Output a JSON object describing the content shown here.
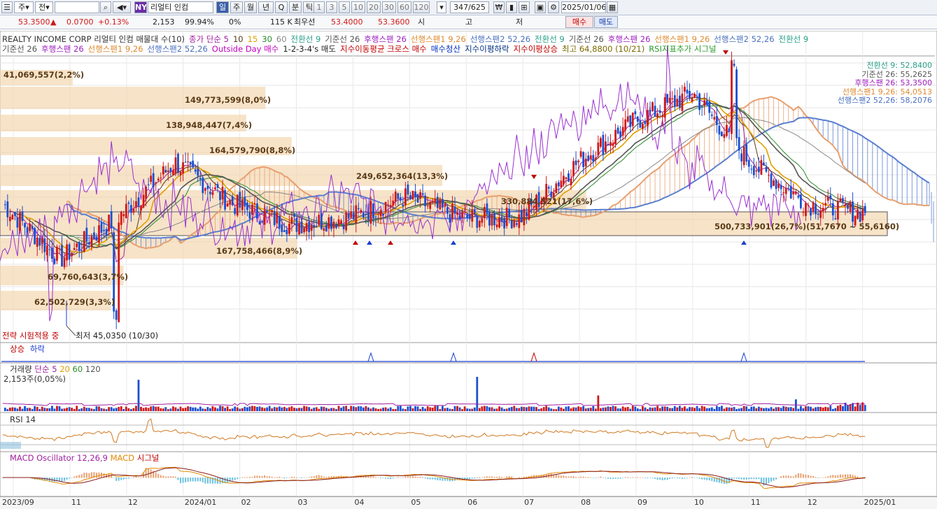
{
  "toolbar1": {
    "period": "주",
    "mode": "전",
    "code_value": "",
    "market_badge": "NY",
    "stock_name": "리얼티 인컴",
    "intervals": [
      "일",
      "주",
      "월",
      "년",
      "Q",
      "분",
      "틱"
    ],
    "minute_values": [
      "1",
      "3",
      "5",
      "10",
      "20",
      "30",
      "60",
      "120"
    ],
    "pagination": "347/625",
    "date": "2025/01/06",
    "buy_label": "매수",
    "sell_label": "매도"
  },
  "toolbar2": {
    "price": "53.3500",
    "change": "0.0700",
    "change_pct": "+0.13%",
    "volume": "2,153",
    "ratio": "99.94%",
    "zero_pct": "0%",
    "k_volume": "115 K",
    "best_ask_label": "최우선",
    "best_ask": "53.4000",
    "best_bid": "53.3600",
    "open_label": "시",
    "high_label": "고",
    "low_label": "저"
  },
  "legend1": [
    {
      "text": "REALTY INCOME CORP 리얼티 인컴 매물대 수(10)",
      "color": "#333333"
    },
    {
      "text": "종가 단순 5",
      "color": "#a020a0"
    },
    {
      "text": "10",
      "color": "#5a3b17"
    },
    {
      "text": "15",
      "color": "#e0a000"
    },
    {
      "text": "30",
      "color": "#2a8a2a"
    },
    {
      "text": "60",
      "color": "#888888"
    },
    {
      "text": "전환선 9",
      "color": "#2aa08a"
    },
    {
      "text": "기준선 26",
      "color": "#555555"
    },
    {
      "text": "후행스팬 26",
      "color": "#a020c0"
    },
    {
      "text": "선행스팬1 9,26",
      "color": "#e08a30"
    },
    {
      "text": "선행스팬2 52,26",
      "color": "#4a70c0"
    },
    {
      "text": "전환선 9",
      "color": "#2aa08a"
    },
    {
      "text": "기준선 26",
      "color": "#555555"
    },
    {
      "text": "후행스팬 26",
      "color": "#a020c0"
    },
    {
      "text": "선행스팬1 9,26",
      "color": "#e08a30"
    },
    {
      "text": "선행스팬2 52,26",
      "color": "#4a70c0"
    },
    {
      "text": "전환선 9",
      "color": "#2aa08a"
    }
  ],
  "legend2": [
    {
      "text": "기준선 26",
      "color": "#555555"
    },
    {
      "text": "후행스팬 26",
      "color": "#a020c0"
    },
    {
      "text": "선행스팬1 9,26",
      "color": "#e08a30"
    },
    {
      "text": "선행스팬2 52,26",
      "color": "#4a70c0"
    },
    {
      "text": "Outside Day 매수",
      "color": "#c000c0"
    },
    {
      "text": "1-2-3-4's 매도",
      "color": "#222222"
    },
    {
      "text": "지수이동평균 크로스 매수",
      "color": "#c00000"
    },
    {
      "text": "매수청산",
      "color": "#0030c0"
    },
    {
      "text": "지수이평하락",
      "color": "#003080"
    },
    {
      "text": "지수이평상승",
      "color": "#c00000"
    },
    {
      "text": "최고 64,8800 (10/21)",
      "color": "#7a6a00"
    },
    {
      "text": "RSI지표추가 시그널",
      "color": "#2a9a2a"
    }
  ],
  "right_labels": [
    {
      "text": "전환선 9: 52,8400",
      "color": "#2aa08a"
    },
    {
      "text": "기준선 26: 55,2625",
      "color": "#555555"
    },
    {
      "text": "후행스팬 26: 53,3500",
      "color": "#a020c0"
    },
    {
      "text": "선행스팬1 9,26: 54,0513",
      "color": "#e08a30"
    },
    {
      "text": "선행스팬2 52,26: 58,2076",
      "color": "#4a70c0"
    }
  ],
  "profile_labels": [
    "41,069,557(2,2%)",
    "149,773,599(8,0%)",
    "138,948,447(7,4%)",
    "164,579,790(8,8%)",
    "249,652,364(13,3%)",
    "330,884,521(17,6%)",
    "500,733,901(26,7%)(51,7670 ~ 55,6160)",
    "167,758,466(8,9%)",
    "69,760,643(3,7%)",
    "62,502,729(3,3%)"
  ],
  "low_note": "최저 45,0350 (10/30)",
  "strategy_note": "전략 시험적용 중",
  "signal_panel": {
    "up": "상승",
    "down": "하락"
  },
  "volume_panel": {
    "title": "거래량",
    "ma": [
      "단순 5",
      "20",
      "60",
      "120"
    ],
    "value": "2,153주(0,05%)"
  },
  "rsi_panel": {
    "title": "RSI 14"
  },
  "macd_panel": {
    "title": "MACD Oscillator 12,26,9",
    "macd": "MACD",
    "signal": "시그널"
  },
  "x_labels": [
    "2023/09",
    "11",
    "12",
    "2024/01",
    "02",
    "03",
    "04",
    "05",
    "06",
    "07",
    "08",
    "09",
    "10",
    "11",
    "12",
    "2025/01"
  ],
  "colors": {
    "up": "#d01818",
    "down": "#1a4fd0",
    "cloud_up": "#e7a070",
    "cloud_down": "#5a7fd0"
  },
  "chart_data": {
    "type": "candlestick",
    "x_labels": [
      "2023/09",
      "11",
      "12",
      "2024/01",
      "02",
      "03",
      "04",
      "05",
      "06",
      "07",
      "08",
      "09",
      "10",
      "11",
      "12",
      "2025/01"
    ],
    "ylim": [
      45,
      65
    ],
    "closes_monthly": [
      54,
      50,
      53,
      57,
      54,
      52.5,
      53,
      54.5,
      53,
      53,
      57,
      60,
      62,
      57,
      54,
      53.35
    ],
    "high": 64.88,
    "low": 45.035,
    "last": 53.35,
    "volume_profile": [
      {
        "label": "41,069,557(2,2%)",
        "value": 41069557
      },
      {
        "label": "149,773,599(8,0%)",
        "value": 149773599
      },
      {
        "label": "138,948,447(7,4%)",
        "value": 138948447
      },
      {
        "label": "164,579,790(8,8%)",
        "value": 164579790
      },
      {
        "label": "249,652,364(13,3%)",
        "value": 249652364
      },
      {
        "label": "330,884,521(17,6%)",
        "value": 330884521
      },
      {
        "label": "500,733,901(26,7%)",
        "value": 500733901
      },
      {
        "label": "167,758,466(8,9%)",
        "value": 167758466
      },
      {
        "label": "69,760,643(3,7%)",
        "value": 69760643
      },
      {
        "label": "62,502,729(3,3%)",
        "value": 62502729
      }
    ]
  }
}
